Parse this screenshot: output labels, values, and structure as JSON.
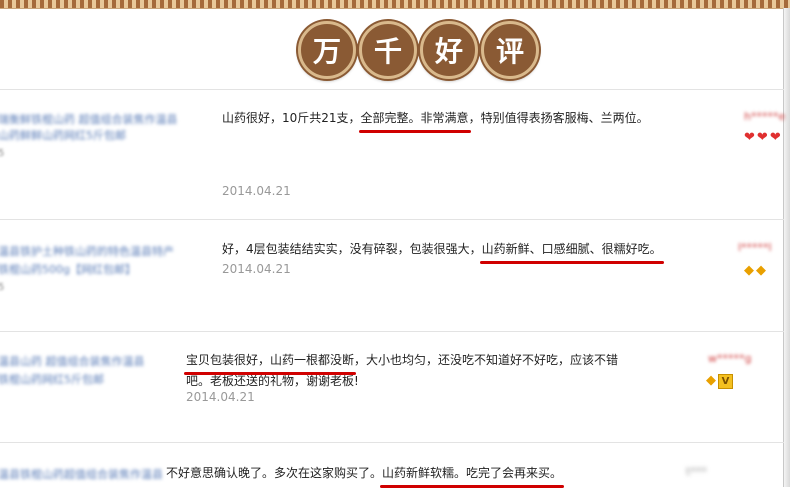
{
  "banner": {
    "chars": [
      "万",
      "千",
      "好",
      "评"
    ]
  },
  "reviews": [
    {
      "product": [
        "瑞衡鲜铁棍山药 超值组合装焦作温县",
        "山药鲜鲜山药网红5斤包邮",
        "5"
      ],
      "text_before": "山药很好，10斤共21支，",
      "highlight": "全部完整。非常满意",
      "text_after": "，特别值得表扬客服梅、兰两位。",
      "date": "2014.04.21",
      "username": "h*****e",
      "badge": "heart"
    },
    {
      "product": [
        "温县铁护土种铁山药的特色温县特产",
        "铁棍山药500g【网红包邮】",
        "5"
      ],
      "text_before": "好，4层包装结结实实，没有碎裂，包装很强大，",
      "highlight": "山药新鲜、口感细腻、很糯好吃。",
      "text_after": "",
      "date": "2014.04.21",
      "username": "l*****l",
      "badge": "diamond"
    },
    {
      "product": [
        "温县山药 超值组合装焦作温县",
        "铁棍山药网红5斤包邮"
      ],
      "highlight1": "宝贝包装很好，山药一根都没断",
      "line1_after": "，大小也均匀，还没吃不知道好不好吃，应该不错",
      "line2": "吧。老板还送的礼物，谢谢老板!",
      "date": "2014.04.21",
      "username": "w*****g",
      "badge": "diamond-vip"
    },
    {
      "product": [
        "温县铁棍山药超值组合装焦作温县"
      ],
      "text_before": "不好意思确认晚了。多次在这家购买了。",
      "highlight": "山药新鲜软糯。吃完了会再来买。",
      "text_after": "",
      "username": "t***"
    }
  ]
}
